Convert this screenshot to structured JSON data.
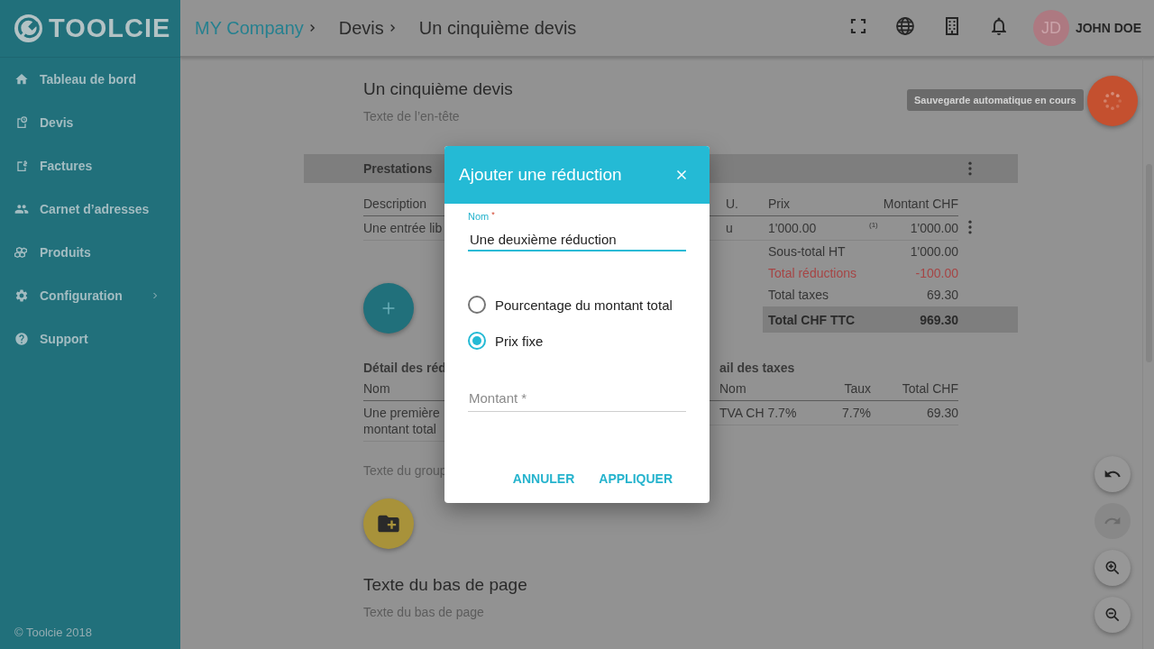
{
  "sidebar": {
    "logo": "TOOLCIE",
    "items": [
      {
        "label": "Tableau de bord",
        "submenu": false
      },
      {
        "label": "Devis",
        "submenu": false
      },
      {
        "label": "Factures",
        "submenu": false
      },
      {
        "label": "Carnet d’adresses",
        "submenu": false
      },
      {
        "label": "Produits",
        "submenu": false
      },
      {
        "label": "Configuration",
        "submenu": true
      },
      {
        "label": "Support",
        "submenu": false
      }
    ],
    "footer": "© Toolcie 2018"
  },
  "topbar": {
    "breadcrumbs": [
      {
        "label": "MY Company",
        "kind": "link"
      },
      {
        "label": "Devis",
        "kind": "section"
      },
      {
        "label": "Un cinquième devis",
        "kind": "current"
      }
    ],
    "user": {
      "initials": "JD",
      "name": "JOHN DOE"
    }
  },
  "document": {
    "title": "Un cinquième devis",
    "header_placeholder": "Texte de l’en-tête",
    "services": {
      "title": "Prestations",
      "columns": [
        "Description",
        "U.",
        "Prix",
        "Montant CHF"
      ],
      "rows": [
        {
          "description": "Une entrée lib",
          "unit": "u",
          "price": "1'000.00",
          "note": "(1)",
          "amount": "1'000.00"
        }
      ]
    },
    "totals": [
      {
        "label": "Sous-total HT",
        "value": "1'000.00",
        "kind": "normal"
      },
      {
        "label": "Total réductions",
        "value": "-100.00",
        "kind": "discount"
      },
      {
        "label": "Total taxes",
        "value": "69.30",
        "kind": "normal"
      },
      {
        "label": "Total CHF TTC",
        "value": "969.30",
        "kind": "grand"
      }
    ],
    "discounts": {
      "title": "Détail des réd",
      "columns": [
        "Nom"
      ],
      "rows": [
        {
          "lines": [
            "Une première",
            "montant total"
          ]
        }
      ]
    },
    "taxes": {
      "title": "ail des taxes",
      "columns": [
        "Nom",
        "Taux",
        "Total CHF"
      ],
      "rows": [
        {
          "name": "TVA CH 7.7%",
          "rate": "7.7%",
          "total": "69.30"
        }
      ]
    },
    "group_placeholder": "Texte du group",
    "footer_title": "Texte du bas de page",
    "footer_placeholder": "Texte du bas de page"
  },
  "autosave": {
    "tooltip": "Sauvegarde automatique en cours"
  },
  "tools": [
    {
      "kind": "undo",
      "disabled": false
    },
    {
      "kind": "redo",
      "disabled": true
    },
    {
      "kind": "zoom-in",
      "disabled": false
    },
    {
      "kind": "zoom-out",
      "disabled": false
    }
  ],
  "dialog": {
    "title": "Ajouter une réduction",
    "name_field": {
      "label": "Nom",
      "mark": "*",
      "value": "Une deuxième réduction"
    },
    "options": [
      {
        "label": "Pourcentage du montant total",
        "selected": false
      },
      {
        "label": "Prix fixe",
        "selected": true
      }
    ],
    "amount_field": {
      "placeholder": "Montant *"
    },
    "buttons": [
      {
        "label": "ANNULER"
      },
      {
        "label": "APPLIQUER"
      }
    ]
  }
}
